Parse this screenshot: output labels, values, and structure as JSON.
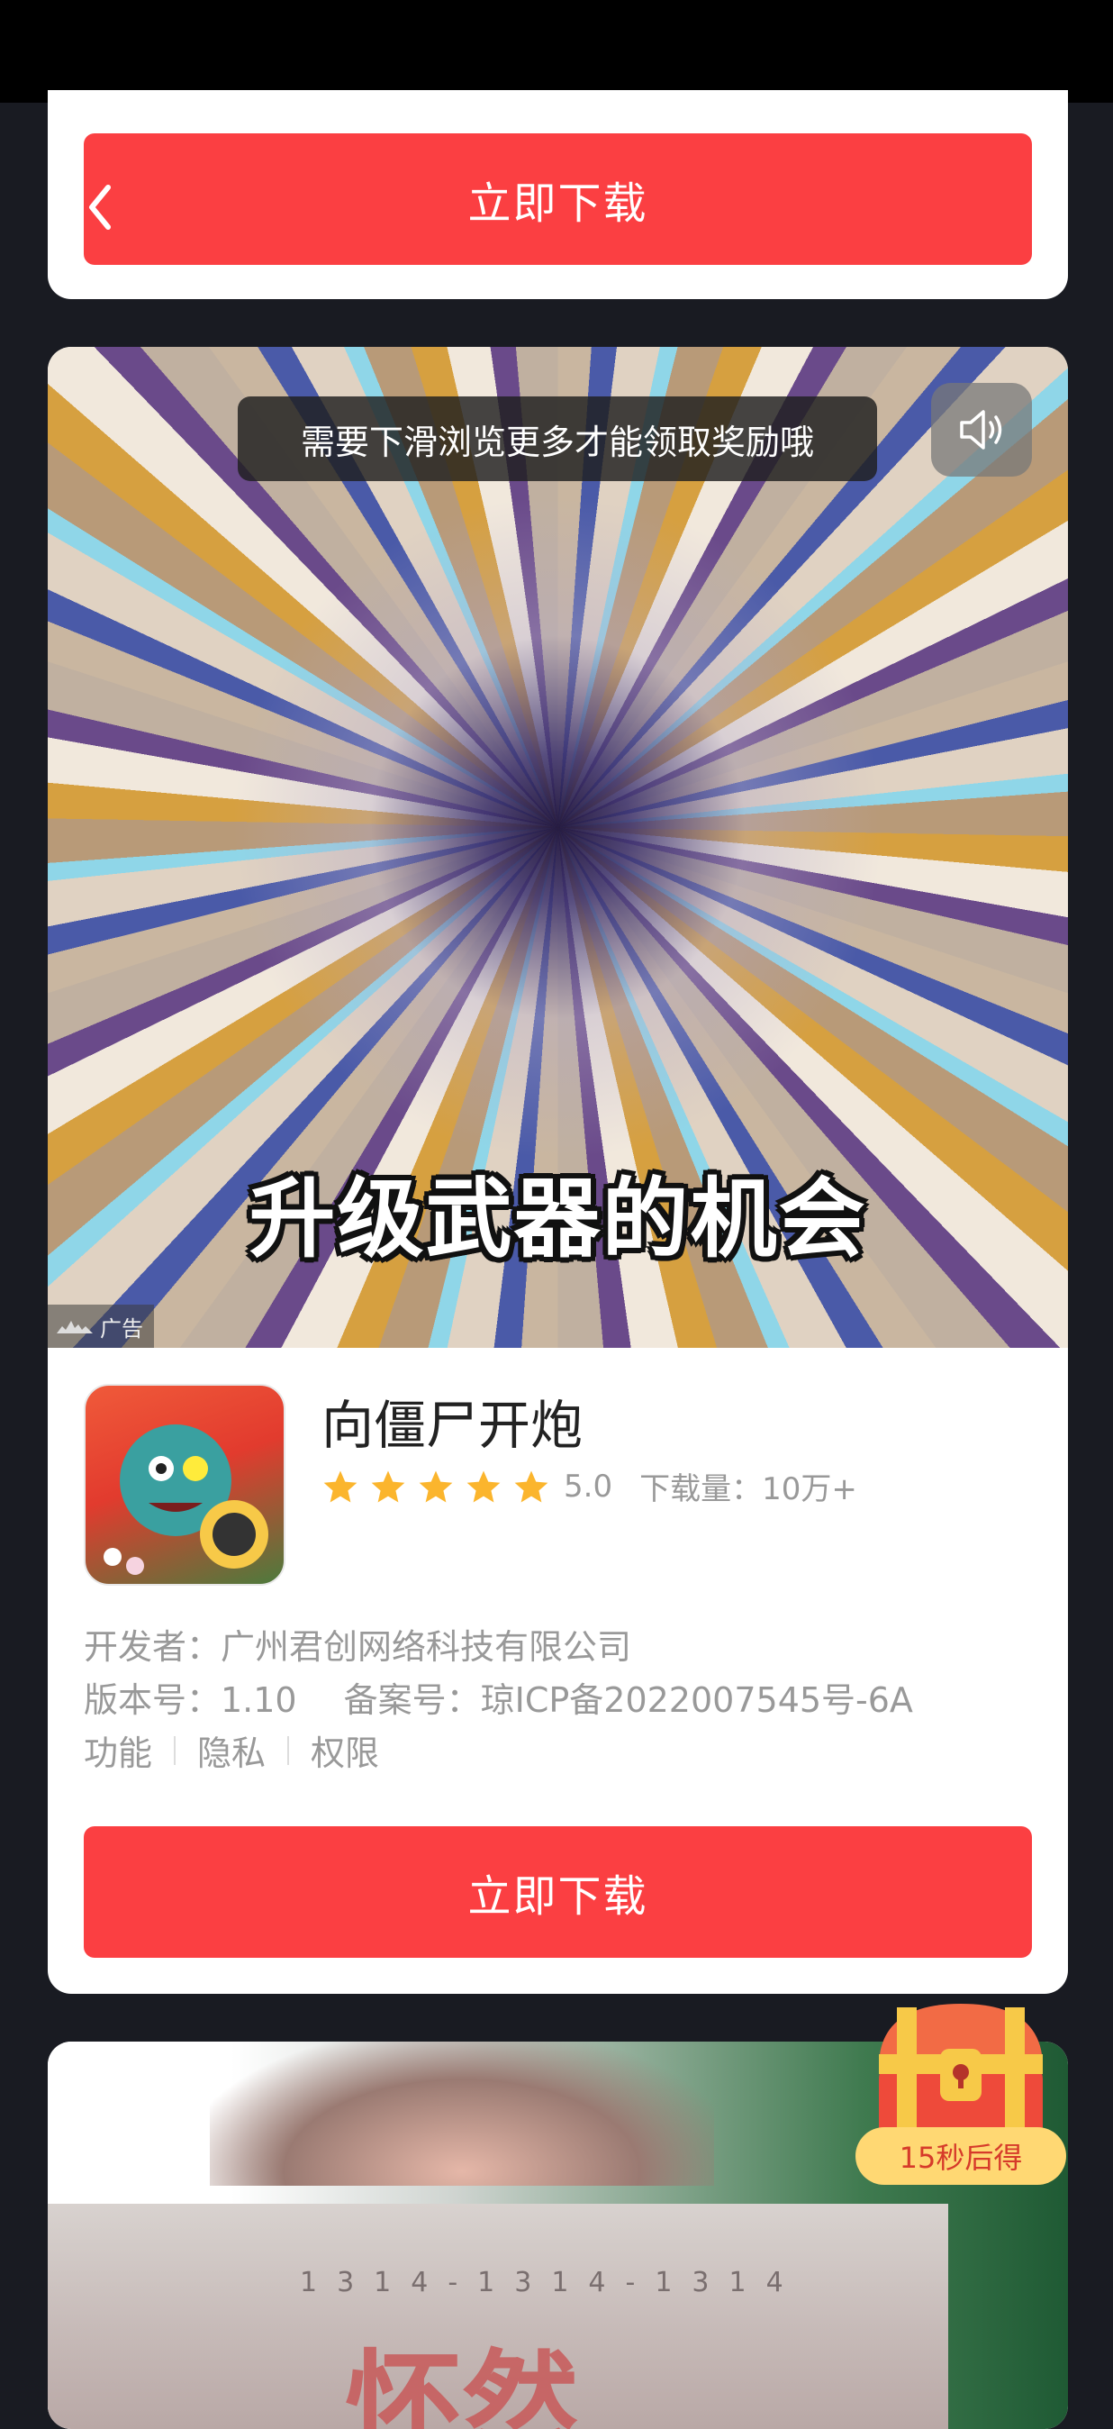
{
  "top_card": {
    "download_label": "立即下载"
  },
  "ad": {
    "hint": "需要下滑浏览更多才能领取奖励哦",
    "video_caption": "升级武器的机会",
    "ad_tag": "广告",
    "app_name": "向僵尸开炮",
    "rating": "5.0",
    "stars": 5,
    "downloads": "下载量：10万+",
    "developer": "开发者：广州君创网络科技有限公司",
    "version": "版本号：1.10",
    "record": "备案号：琼ICP备2022007545号-6A",
    "links": [
      "功能",
      "隐私",
      "权限"
    ],
    "download_label": "立即下载"
  },
  "promo": {
    "digits": "1314-1314-1314",
    "big_text": "怀然"
  },
  "reward": {
    "label": "15秒后得"
  },
  "icons": [
    "back-icon",
    "volume-icon",
    "star-icon",
    "ad-logo-icon",
    "treasure-chest-icon"
  ],
  "colors": {
    "accent": "#fb3f42",
    "star": "#fbb52d",
    "background": "#191b22"
  }
}
